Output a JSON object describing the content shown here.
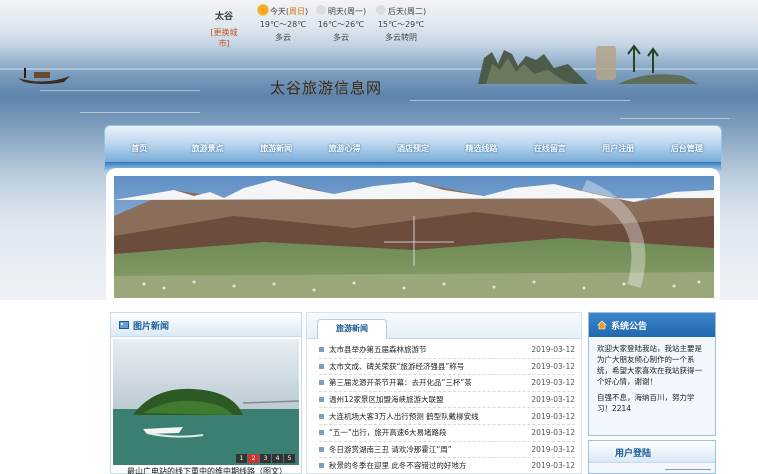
{
  "weather": {
    "city": "太谷",
    "switch_city": "[更换城市]",
    "days": [
      {
        "label": "今天",
        "tag": "周日",
        "temp": "19℃～28℃",
        "desc": "多云",
        "icon": "sun-icon"
      },
      {
        "label": "明天",
        "tag": "周一",
        "temp": "16℃～26℃",
        "desc": "多云",
        "icon": "cloud-icon"
      },
      {
        "label": "后天",
        "tag": "周二",
        "temp": "15℃～29℃",
        "desc": "多云转阴",
        "icon": "cloud-icon"
      }
    ]
  },
  "site_title": "太谷旅游信息网",
  "nav": [
    "首页",
    "旅游景点",
    "旅游新闻",
    "旅游心得",
    "酒店预定",
    "精选线路",
    "在线留言",
    "用户注册",
    "后台管理"
  ],
  "photo_news": {
    "heading": "图片新闻",
    "pager": [
      "1",
      "2",
      "3",
      "4",
      "5"
    ],
    "active_page": 2,
    "caption": "最山广电站的线下重中的维中期线路（图文）"
  },
  "news": {
    "tab": "旅游新闻",
    "items": [
      {
        "title": "太市县举办第五届森林旅游节",
        "date": "2019-03-12"
      },
      {
        "title": "太市文成、碑关荣获“旅游经济强县”称号",
        "date": "2019-03-12"
      },
      {
        "title": "第三届龙源开茶节开幕：去开化品“三杯”茶",
        "date": "2019-03-12"
      },
      {
        "title": "温州12家景区加盟海峡旅游大联盟",
        "date": "2019-03-12"
      },
      {
        "title": "大连机场大客3万人出行预测  鹤型队戴柳安线",
        "date": "2019-03-12"
      },
      {
        "title": "“五一”出行，旅开高速6大易堵路段",
        "date": "2019-03-12"
      },
      {
        "title": "冬日游赏湖南三丑 请欢冷那霍江“周”",
        "date": "2019-03-12"
      },
      {
        "title": "秋景的冬季在迎里 此冬不容错过的好地方",
        "date": "2019-03-12"
      }
    ]
  },
  "notice": {
    "heading": "系统公告",
    "paragraphs": [
      "欢迎大家登陆我站，我站主要是为广大朋友倾心制作的一个系统，希望大家喜欢在我站获得一个好心情，谢谢！",
      "自强不息，海纳百川，努力学习！2214"
    ]
  },
  "login": {
    "heading": "用户登陆"
  },
  "colors": {
    "nav_blue": "#2f79bf",
    "heading_blue": "#1d5b96",
    "weather_accent": "#e07000",
    "switch_city": "#c8552a"
  }
}
